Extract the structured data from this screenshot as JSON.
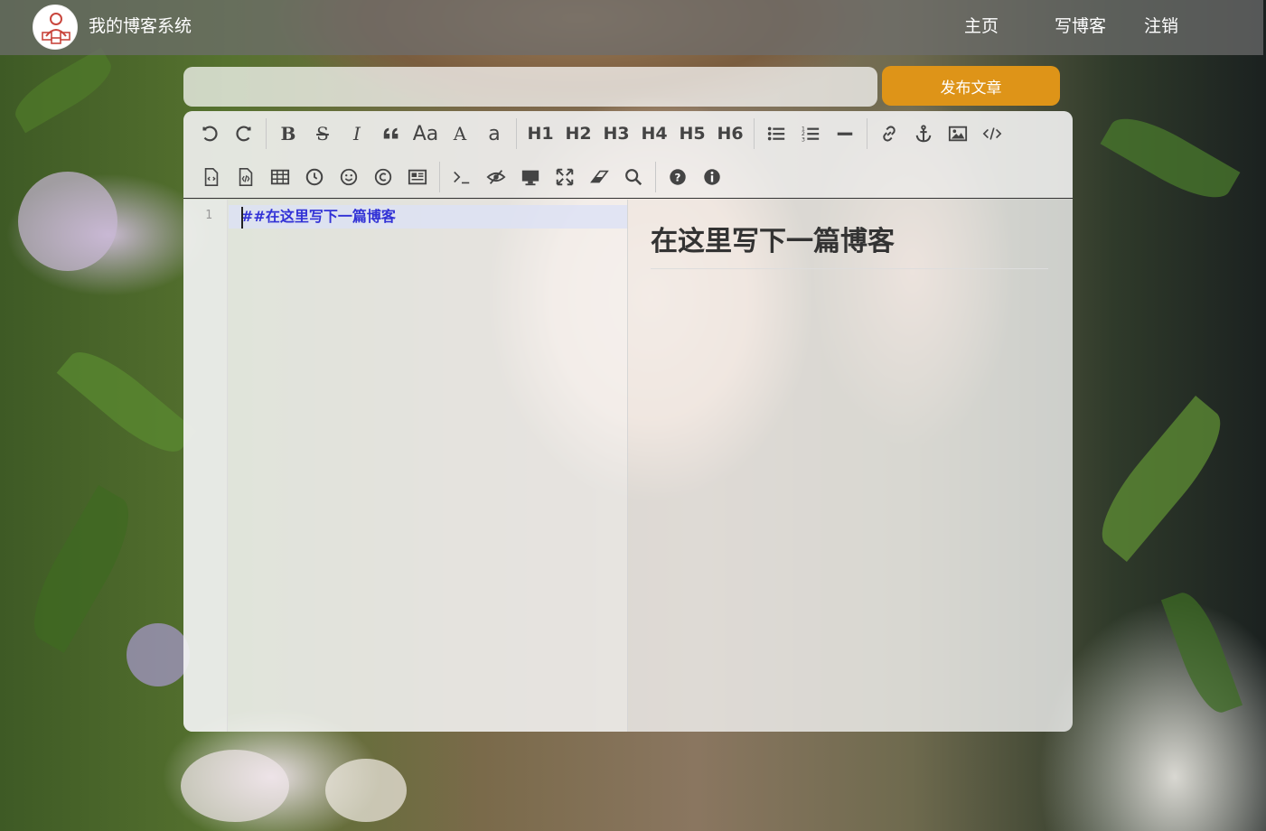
{
  "nav": {
    "brand": "我的博客系统",
    "links": [
      "主页",
      "写博客",
      "注销"
    ]
  },
  "editor": {
    "title_value": "",
    "publish_label": "发布文章",
    "toolbar_row1": [
      "undo-icon",
      "redo-icon",
      "bold-icon",
      "strikethrough-icon",
      "italic-icon",
      "quote-icon",
      "uppercase-first-icon",
      "uppercase-icon",
      "lowercase-icon",
      "H1",
      "H2",
      "H3",
      "H4",
      "H5",
      "H6",
      "unordered-list-icon",
      "ordered-list-icon",
      "horizontal-rule-icon",
      "link-icon",
      "anchor-icon",
      "image-icon",
      "code-icon"
    ],
    "toolbar_row2": [
      "code-block-icon",
      "preformatted-icon",
      "table-icon",
      "datetime-icon",
      "emoji-icon",
      "html-entities-icon",
      "pagebreak-icon",
      "goto-line-icon",
      "watch-toggle-icon",
      "preview-icon",
      "fullscreen-icon",
      "clear-icon",
      "search-icon",
      "help-icon",
      "info-icon"
    ],
    "headings": {
      "h1": "H1",
      "h2": "H2",
      "h3": "H3",
      "h4": "H4",
      "h5": "H5",
      "h6": "H6"
    },
    "glyphs": {
      "aa_first": "Aa",
      "a_upper": "A",
      "a_lower": "a"
    },
    "line_number": "1",
    "code_text": "##在这里写下一篇博客",
    "preview_heading": "在这里写下一篇博客"
  },
  "colors": {
    "nav_bg": "#6e6e6e",
    "publish_bg": "#de9418",
    "code_text": "#3232d6"
  }
}
